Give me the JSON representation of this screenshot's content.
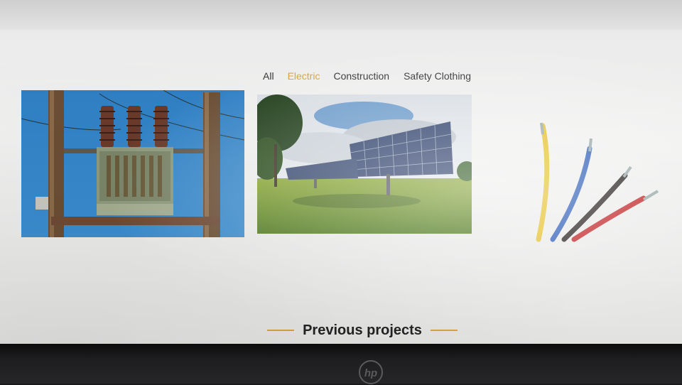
{
  "theme": {
    "accent": "#d9a13b"
  },
  "filters": {
    "items": [
      {
        "label": "All",
        "active": false
      },
      {
        "label": "Electric",
        "active": true
      },
      {
        "label": "Construction",
        "active": false
      },
      {
        "label": "Safety Clothing",
        "active": false
      }
    ]
  },
  "gallery": {
    "items": [
      {
        "subject": "transformer-photo"
      },
      {
        "subject": "solar-panel-photo"
      },
      {
        "subject": "electric-wires-photo"
      }
    ]
  },
  "section": {
    "title": "Previous projects"
  },
  "bezel": {
    "logo_icon": "hp-logo-icon"
  }
}
